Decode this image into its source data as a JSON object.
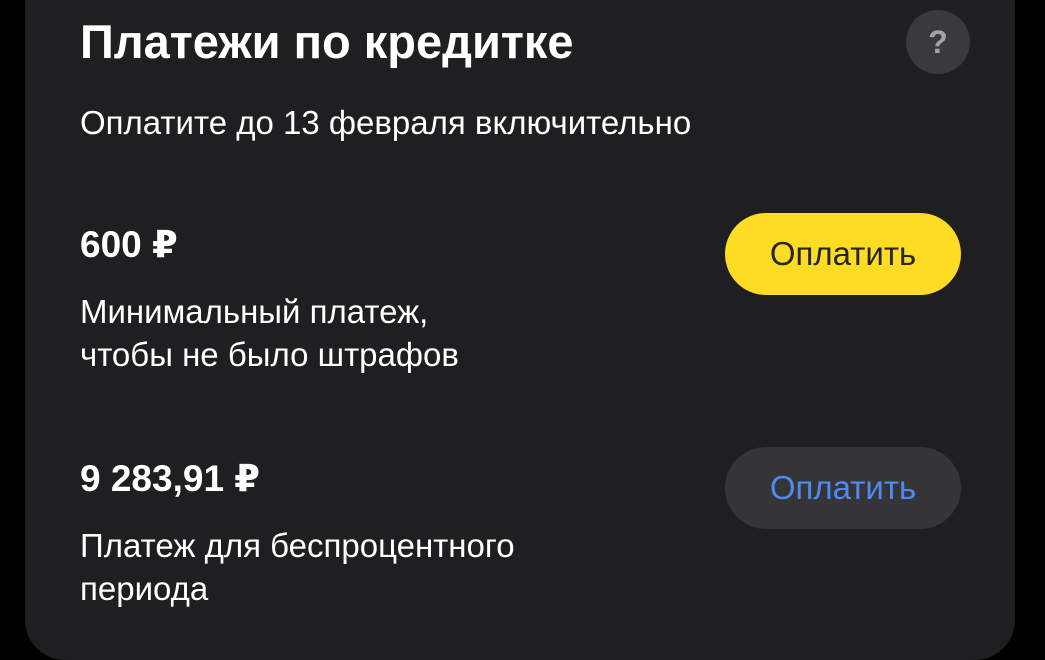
{
  "card": {
    "title": "Платежи по кредитке",
    "help_icon": "question-mark-icon",
    "help_symbol": "?",
    "subtitle": "Оплатите до 13 февраля включительно"
  },
  "payments": [
    {
      "amount": "600 ₽",
      "description_line1": "Минимальный платеж,",
      "description_line2": "чтобы не было штрафов",
      "button_label": "Оплатить",
      "button_style": "primary"
    },
    {
      "amount": "9 283,91 ₽",
      "description_line1": "Платеж для беспроцентного",
      "description_line2": "периода",
      "button_label": "Оплатить",
      "button_style": "secondary"
    }
  ],
  "colors": {
    "background": "#000000",
    "card": "#1f1f21",
    "primary_button": "#fddc23",
    "secondary_button": "#353537",
    "link_text": "#4e8bf0",
    "help_button": "#3a3a3c"
  }
}
